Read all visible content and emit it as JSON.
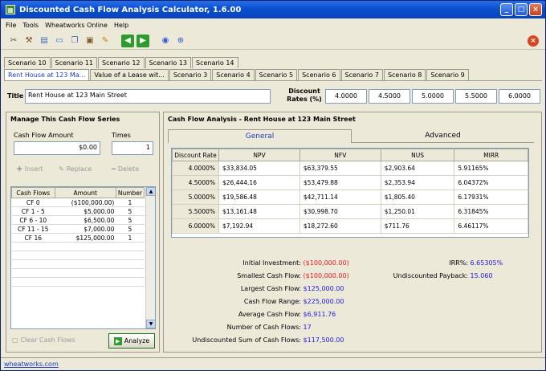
{
  "window": {
    "title": "Discounted Cash Flow Analysis Calculator, 1.6.00"
  },
  "menu": [
    "File",
    "Tools",
    "Wheatworks Online",
    "Help"
  ],
  "toolbar_icons": [
    "cut-icon",
    "wizard-icon",
    "document-icon",
    "print-icon",
    "copy-icon",
    "paste-icon",
    "pencil-icon",
    "back-icon",
    "forward-icon",
    "globe-icon",
    "help-icon"
  ],
  "tabs_row1": [
    "Scenario 10",
    "Scenario 11",
    "Scenario 12",
    "Scenario 13",
    "Scenario 14"
  ],
  "tabs_row2": [
    "Rent House at 123 Ma...",
    "Value of a Lease wit...",
    "Scenario 3",
    "Scenario 4",
    "Scenario 5",
    "Scenario 6",
    "Scenario 7",
    "Scenario 8",
    "Scenario 9"
  ],
  "title_field": {
    "label": "Title",
    "value": "Rent House at 123 Main Street"
  },
  "discount_rates": {
    "label_line1": "Discount",
    "label_line2": "Rates (%)",
    "values": [
      "4.0000",
      "4.5000",
      "5.0000",
      "5.5000",
      "6.0000"
    ]
  },
  "manage": {
    "title": "Manage This Cash Flow Series",
    "amount_label": "Cash Flow Amount",
    "amount_value": "$0.00",
    "times_label": "Times",
    "times_value": "1",
    "insert": "Insert",
    "replace": "Replace",
    "delete": "Delete",
    "columns": [
      "Cash Flows",
      "Amount",
      "Number"
    ],
    "rows": [
      [
        "CF 0",
        "($100,000.00)",
        "1"
      ],
      [
        "CF 1 - 5",
        "$5,000.00",
        "5"
      ],
      [
        "CF 6 - 10",
        "$6,500.00",
        "5"
      ],
      [
        "CF 11 - 15",
        "$7,000.00",
        "5"
      ],
      [
        "CF 16",
        "$125,000.00",
        "1"
      ]
    ],
    "clear": "Clear Cash Flows",
    "analyze": "Analyze"
  },
  "analysis": {
    "title": "Cash Flow Analysis - Rent House at 123 Main Street",
    "tabs": [
      "General",
      "Advanced"
    ],
    "columns": [
      "Discount Rate",
      "NPV",
      "NFV",
      "NUS",
      "MIRR"
    ],
    "rows": [
      [
        "4.0000%",
        "$33,834.05",
        "$63,379.55",
        "$2,903.64",
        "5.91165%"
      ],
      [
        "4.5000%",
        "$26,444.16",
        "$53,479.88",
        "$2,353.94",
        "6.04372%"
      ],
      [
        "5.0000%",
        "$19,586.48",
        "$42,711.14",
        "$1,805.40",
        "6.17931%"
      ],
      [
        "5.5000%",
        "$13,161.48",
        "$30,998.70",
        "$1,250.01",
        "6.31845%"
      ],
      [
        "6.0000%",
        "$7,192.94",
        "$18,272.60",
        "$711.76",
        "6.46117%"
      ]
    ],
    "stats": [
      {
        "label": "Initial Investment:",
        "value": "($100,000.00)",
        "color": "red"
      },
      {
        "label": "Smallest Cash Flow:",
        "value": "($100,000.00)",
        "color": "red"
      },
      {
        "label": "Largest Cash Flow:",
        "value": "$125,000.00",
        "color": "blue"
      },
      {
        "label": "Cash Flow Range:",
        "value": "$225,000.00",
        "color": "blue"
      },
      {
        "label": "Average Cash Flow:",
        "value": "$6,911.76",
        "color": "blue"
      },
      {
        "label": "Number of Cash Flows:",
        "value": "17",
        "color": "blue"
      },
      {
        "label": "Undiscounted Sum of Cash Flows:",
        "value": "$117,500.00",
        "color": "blue"
      }
    ],
    "irr_label": "IRR%:",
    "irr_value": "6.65305%",
    "payback_label": "Undiscounted Payback:",
    "payback_value": "15.060"
  },
  "status": {
    "link": "wheatworks.com"
  },
  "colors": {
    "accent": "#1a3ec0",
    "negative": "#e02020",
    "positive": "#2020d8"
  }
}
